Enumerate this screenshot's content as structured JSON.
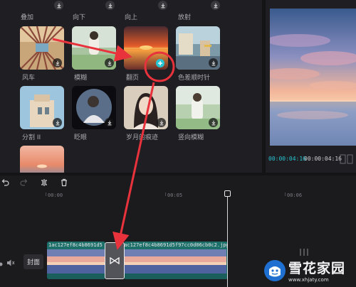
{
  "effects": {
    "top_row_labels": [
      "叠加",
      "向下",
      "向上",
      "放射"
    ],
    "items": [
      {
        "label": "风车"
      },
      {
        "label": "模糊"
      },
      {
        "label": "翻页"
      },
      {
        "label": "色差顺时针"
      },
      {
        "label": "分割 II"
      },
      {
        "label": "眨眼"
      },
      {
        "label": "岁月的痕迹"
      },
      {
        "label": "竖向模糊"
      },
      {
        "label": ""
      }
    ]
  },
  "preview": {
    "current_time": "00:00:04:16",
    "total_time": "00:00:04:16"
  },
  "timeline": {
    "ruler_labels": [
      "00:00",
      "00:05",
      "00:06"
    ],
    "cover_label": "封面",
    "clip1_name": "1ac127ef8c4b8691d5",
    "clip2_name": "1ac127ef8c4b8691d5f97cc0d06cb0c2.jpg"
  },
  "watermark": {
    "text": "雪花家园",
    "url": "www.xhjaty.com"
  },
  "colors": {
    "accent": "#27c4d4",
    "annotation": "#e8323c",
    "clip": "#1d6f6a"
  }
}
